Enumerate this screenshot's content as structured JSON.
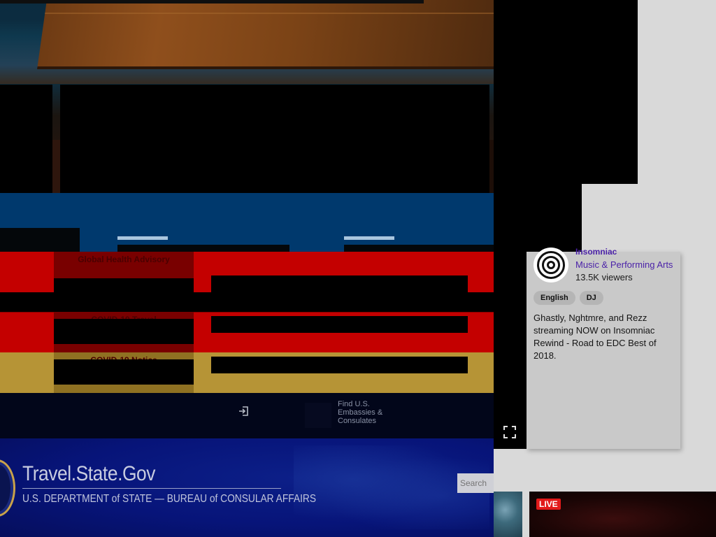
{
  "gov": {
    "brand_title": "Travel.State.Gov",
    "brand_subtitle": "U.S. DEPARTMENT of STATE — BUREAU of CONSULAR AFFAIRS",
    "search_placeholder": "Search",
    "nav": {
      "embassies_lines": [
        "Find U.S.",
        "Embassies &",
        "Consulates"
      ]
    },
    "alerts": [
      {
        "label": "Global Health Advisory",
        "color": "#c40000"
      },
      {
        "label": "COVID-19 Travel",
        "color": "#c40000"
      },
      {
        "label": "COVID-19 Notice",
        "color": "#b69436"
      }
    ]
  },
  "stream": {
    "channel": "Insomniac",
    "category": "Music & Performing Arts",
    "viewers": "13.5K viewers",
    "tags": [
      "English",
      "DJ"
    ],
    "description": "Ghastly, Nghtmre, and Rezz streaming NOW on Insomniac Rewind - Road to EDC Best of 2018.",
    "live_badge": "LIVE"
  },
  "icons": {
    "signin": "sign-in-icon",
    "fullscreen": "fullscreen-icon"
  }
}
